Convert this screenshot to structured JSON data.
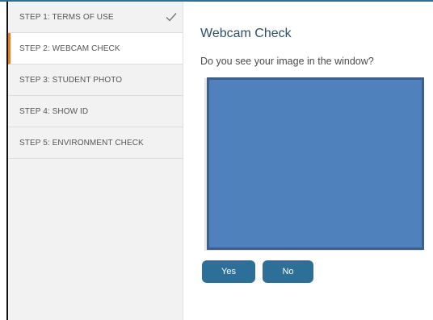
{
  "sidebar": {
    "steps": [
      {
        "label": "STEP 1: TERMS OF USE",
        "status": "completed",
        "icon": "check-icon"
      },
      {
        "label": "STEP 2: WEBCAM CHECK",
        "status": "active"
      },
      {
        "label": "STEP 3: STUDENT PHOTO",
        "status": "pending"
      },
      {
        "label": "STEP 4: SHOW ID",
        "status": "pending"
      },
      {
        "label": "STEP 5: ENVIRONMENT CHECK",
        "status": "pending"
      }
    ]
  },
  "main": {
    "title": "Webcam Check",
    "question": "Do you see your image in the window?",
    "video_color": "#4f81bd"
  },
  "buttons": {
    "yes_label": "Yes",
    "no_label": "No"
  },
  "colors": {
    "accent": "#ef7c22",
    "button": "#2e6f97",
    "title": "#2b4f6b"
  }
}
